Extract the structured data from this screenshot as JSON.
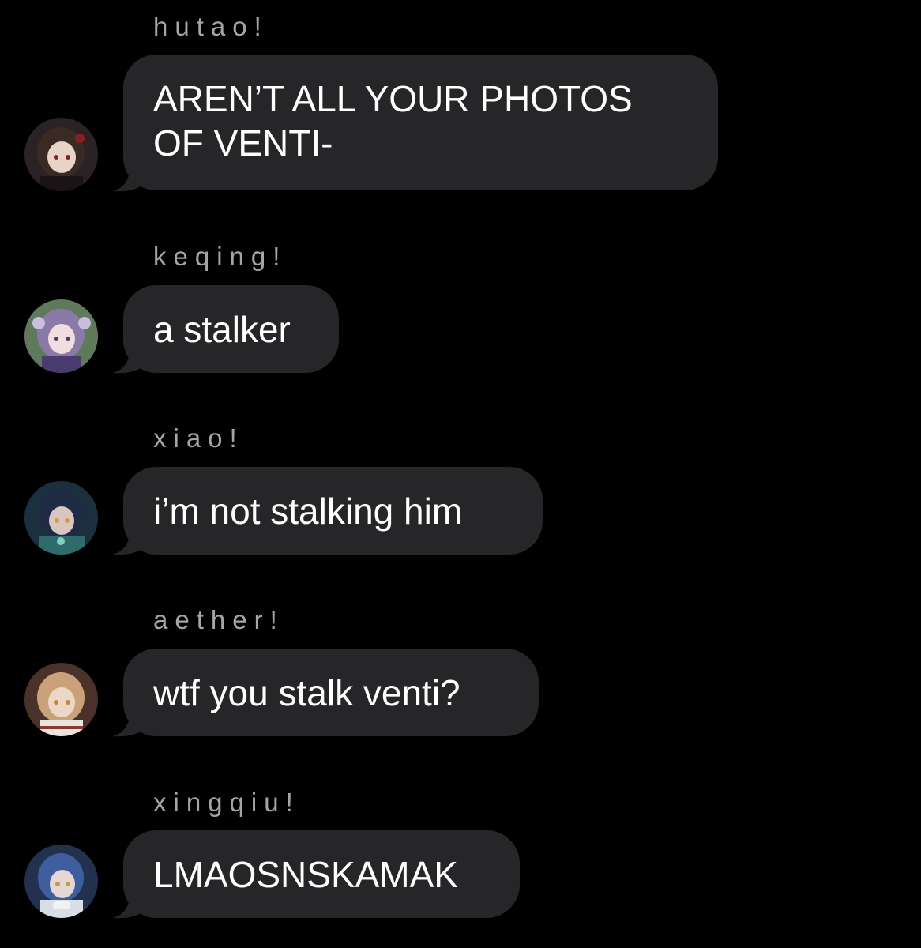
{
  "thread": {
    "messages": [
      {
        "sender": "hutao!",
        "text_lines": [
          "AREN’T ALL YOUR PHOTOS",
          "OF VENTI-"
        ],
        "avatar": {
          "icon": "hutao-avatar",
          "bg": "#2b2226",
          "hair": "#3a2a24",
          "face": "#e8d3c8",
          "accent": "#8a1f23"
        }
      },
      {
        "sender": "keqing!",
        "text_lines": [
          "a stalker"
        ],
        "avatar": {
          "icon": "keqing-avatar",
          "bg": "#5f7a5a",
          "hair": "#8b7aa8",
          "face": "#f0dde0",
          "accent": "#4a3b6e"
        }
      },
      {
        "sender": "xiao!",
        "text_lines": [
          "i’m not stalking him"
        ],
        "avatar": {
          "icon": "xiao-avatar",
          "bg": "#1c2f3f",
          "hair": "#1f2a45",
          "face": "#d9c6c0",
          "accent": "#2f6b6a"
        }
      },
      {
        "sender": "aether!",
        "text_lines": [
          "wtf you stalk venti?"
        ],
        "avatar": {
          "icon": "aether-avatar",
          "bg": "#4a3129",
          "hair": "#c9a27a",
          "face": "#ecd7c6",
          "accent": "#e8e4e0"
        }
      },
      {
        "sender": "xingqiu!",
        "text_lines": [
          "LMAOSNSKAMAK"
        ],
        "avatar": {
          "icon": "xingqiu-avatar",
          "bg": "#22314e",
          "hair": "#3f5e9e",
          "face": "#e6d6d6",
          "accent": "#d8dde6"
        }
      }
    ]
  },
  "colors": {
    "background": "#000000",
    "bubble": "#262629",
    "sender_label": "#a4a4a9",
    "message_text": "#ffffff"
  }
}
